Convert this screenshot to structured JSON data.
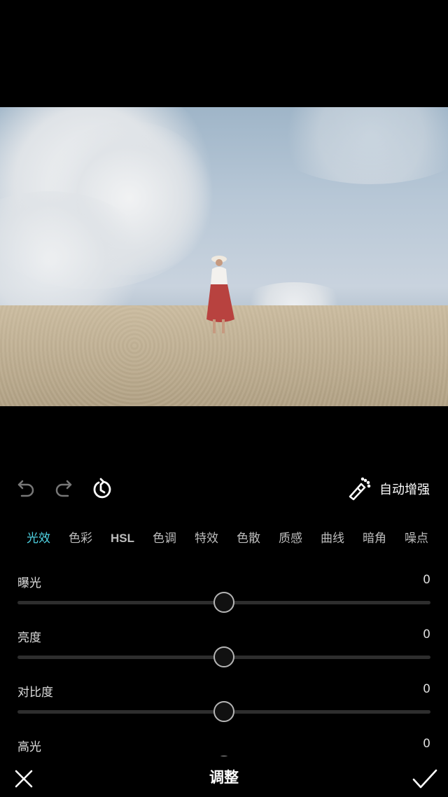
{
  "accent_color": "#4fd3e3",
  "toolbar": {
    "undo_icon": "undo-icon",
    "redo_icon": "redo-icon",
    "history_icon": "history-icon",
    "auto_enhance_icon": "magic-wand-icon",
    "auto_enhance_label": "自动增强"
  },
  "tabs": [
    {
      "label": "光效",
      "active": true
    },
    {
      "label": "色彩"
    },
    {
      "label": "HSL"
    },
    {
      "label": "色调"
    },
    {
      "label": "特效"
    },
    {
      "label": "色散"
    },
    {
      "label": "质感"
    },
    {
      "label": "曲线"
    },
    {
      "label": "暗角"
    },
    {
      "label": "噪点"
    }
  ],
  "adjustments": [
    {
      "label": "曝光",
      "value": "0",
      "level": 0
    },
    {
      "label": "亮度",
      "value": "0",
      "level": 0
    },
    {
      "label": "对比度",
      "value": "0",
      "level": 0
    },
    {
      "label": "高光",
      "value": "0",
      "level": 0
    }
  ],
  "slider_range": [
    -100,
    100
  ],
  "bottom": {
    "close_icon": "close-icon",
    "title": "调整",
    "confirm_icon": "check-icon"
  }
}
